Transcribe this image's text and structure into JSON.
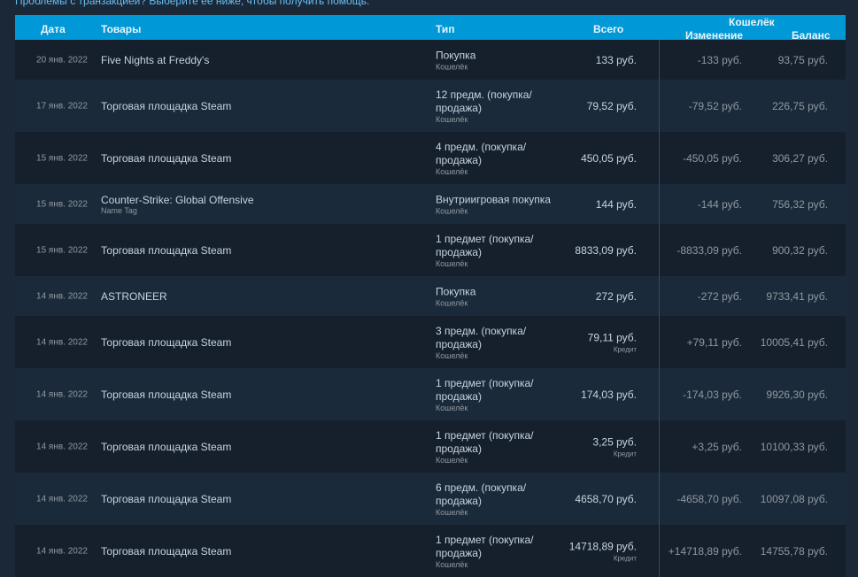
{
  "help_text": "Проблемы с транзакцией? Выберите ее ниже, чтобы получить помощь.",
  "header": {
    "date": "Дата",
    "items": "Товары",
    "type": "Тип",
    "total": "Всего",
    "wallet": "Кошелёк",
    "change": "Изменение",
    "balance": "Баланс"
  },
  "rows": [
    {
      "date": "20 янв. 2022",
      "item": "Five Nights at Freddy's",
      "item_sub": "",
      "type": "Покупка",
      "type_sub": "Кошелёк",
      "total": "133 руб.",
      "total_sub": "",
      "change": "-133 руб.",
      "balance": "93,75 руб."
    },
    {
      "date": "17 янв. 2022",
      "item": "Торговая площадка Steam",
      "item_sub": "",
      "type": "12 предм. (покупка/ продажа)",
      "type_sub": "Кошелёк",
      "total": "79,52 руб.",
      "total_sub": "",
      "change": "-79,52 руб.",
      "balance": "226,75 руб."
    },
    {
      "date": "15 янв. 2022",
      "item": "Торговая площадка Steam",
      "item_sub": "",
      "type": "4 предм. (покупка/ продажа)",
      "type_sub": "Кошелёк",
      "total": "450,05 руб.",
      "total_sub": "",
      "change": "-450,05 руб.",
      "balance": "306,27 руб."
    },
    {
      "date": "15 янв. 2022",
      "item": "Counter-Strike: Global Offensive",
      "item_sub": "Name Tag",
      "type": "Внутриигровая покупка",
      "type_sub": "Кошелёк",
      "total": "144 руб.",
      "total_sub": "",
      "change": "-144 руб.",
      "balance": "756,32 руб."
    },
    {
      "date": "15 янв. 2022",
      "item": "Торговая площадка Steam",
      "item_sub": "",
      "type": "1 предмет (покупка/ продажа)",
      "type_sub": "Кошелёк",
      "total": "8833,09 руб.",
      "total_sub": "",
      "change": "-8833,09 руб.",
      "balance": "900,32 руб."
    },
    {
      "date": "14 янв. 2022",
      "item": "ASTRONEER",
      "item_sub": "",
      "type": "Покупка",
      "type_sub": "Кошелёк",
      "total": "272 руб.",
      "total_sub": "",
      "change": "-272 руб.",
      "balance": "9733,41 руб."
    },
    {
      "date": "14 янв. 2022",
      "item": "Торговая площадка Steam",
      "item_sub": "",
      "type": "3 предм. (покупка/ продажа)",
      "type_sub": "Кошелёк",
      "total": "79,11 руб.",
      "total_sub": "Кредит",
      "change": "+79,11 руб.",
      "balance": "10005,41 руб."
    },
    {
      "date": "14 янв. 2022",
      "item": "Торговая площадка Steam",
      "item_sub": "",
      "type": "1 предмет (покупка/ продажа)",
      "type_sub": "Кошелёк",
      "total": "174,03 руб.",
      "total_sub": "",
      "change": "-174,03 руб.",
      "balance": "9926,30 руб."
    },
    {
      "date": "14 янв. 2022",
      "item": "Торговая площадка Steam",
      "item_sub": "",
      "type": "1 предмет (покупка/ продажа)",
      "type_sub": "Кошелёк",
      "total": "3,25 руб.",
      "total_sub": "Кредит",
      "change": "+3,25 руб.",
      "balance": "10100,33 руб."
    },
    {
      "date": "14 янв. 2022",
      "item": "Торговая площадка Steam",
      "item_sub": "",
      "type": "6 предм. (покупка/ продажа)",
      "type_sub": "Кошелёк",
      "total": "4658,70 руб.",
      "total_sub": "",
      "change": "-4658,70 руб.",
      "balance": "10097,08 руб."
    },
    {
      "date": "14 янв. 2022",
      "item": "Торговая площадка Steam",
      "item_sub": "",
      "type": "1 предмет (покупка/ продажа)",
      "type_sub": "Кошелёк",
      "total": "14718,89 руб.",
      "total_sub": "Кредит",
      "change": "+14718,89 руб.",
      "balance": "14755,78 руб."
    }
  ]
}
